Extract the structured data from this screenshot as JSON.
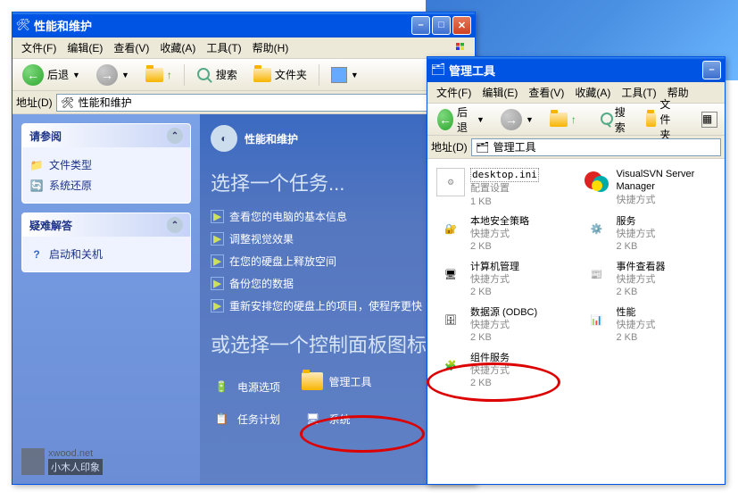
{
  "win1": {
    "title": "性能和维护",
    "menu": {
      "file": "文件(F)",
      "edit": "编辑(E)",
      "view": "查看(V)",
      "fav": "收藏(A)",
      "tools": "工具(T)",
      "help": "帮助(H)"
    },
    "toolbar": {
      "back": "后退",
      "search": "搜索",
      "folders": "文件夹"
    },
    "address": {
      "label": "地址(D)",
      "value": "性能和维护"
    },
    "sidebar": {
      "box1": {
        "title": "请参阅",
        "items": [
          {
            "icon": "folder-type",
            "label": "文件类型"
          },
          {
            "icon": "restore",
            "label": "系统还原"
          }
        ]
      },
      "box2": {
        "title": "疑难解答",
        "items": [
          {
            "icon": "help",
            "label": "启动和关机"
          }
        ]
      }
    },
    "watermark": {
      "line1": "xwood.net",
      "line2": "小木人印象"
    },
    "main": {
      "heading": "性能和维护",
      "section1": "选择一个任务...",
      "tasks": [
        "查看您的电脑的基本信息",
        "调整视觉效果",
        "在您的硬盘上释放空间",
        "备份您的数据",
        "重新安排您的硬盘上的项目，使程序更快"
      ],
      "section2": "或选择一个控制面板图标",
      "links": [
        {
          "icon": "power",
          "label": "电源选项"
        },
        {
          "icon": "admin",
          "label": "管理工具"
        },
        {
          "icon": "task",
          "label": "任务计划"
        },
        {
          "icon": "system",
          "label": "系统"
        }
      ]
    }
  },
  "win2": {
    "title": "管理工具",
    "menu": {
      "file": "文件(F)",
      "edit": "编辑(E)",
      "view": "查看(V)",
      "fav": "收藏(A)",
      "tools": "工具(T)",
      "help": "帮助"
    },
    "toolbar": {
      "back": "后退",
      "search": "搜索",
      "folders": "文件夹"
    },
    "address": {
      "label": "地址(D)",
      "value": "管理工具"
    },
    "files": [
      {
        "icon": "ini",
        "name": "desktop.ini",
        "meta1": "配置设置",
        "meta2": "1 KB"
      },
      {
        "icon": "svn",
        "name": "VisualSVN Server Manager",
        "meta1": "快捷方式",
        "meta2": ""
      },
      {
        "icon": "secpol",
        "name": "本地安全策略",
        "meta1": "快捷方式",
        "meta2": "2 KB"
      },
      {
        "icon": "services",
        "name": "服务",
        "meta1": "快捷方式",
        "meta2": "2 KB"
      },
      {
        "icon": "compmgmt",
        "name": "计算机管理",
        "meta1": "快捷方式",
        "meta2": "2 KB"
      },
      {
        "icon": "event",
        "name": "事件查看器",
        "meta1": "快捷方式",
        "meta2": "2 KB"
      },
      {
        "icon": "odbc",
        "name": "数据源 (ODBC)",
        "meta1": "快捷方式",
        "meta2": "2 KB"
      },
      {
        "icon": "perf",
        "name": "性能",
        "meta1": "快捷方式",
        "meta2": "2 KB"
      },
      {
        "icon": "comsvc",
        "name": "组件服务",
        "meta1": "快捷方式",
        "meta2": "2 KB"
      }
    ]
  }
}
